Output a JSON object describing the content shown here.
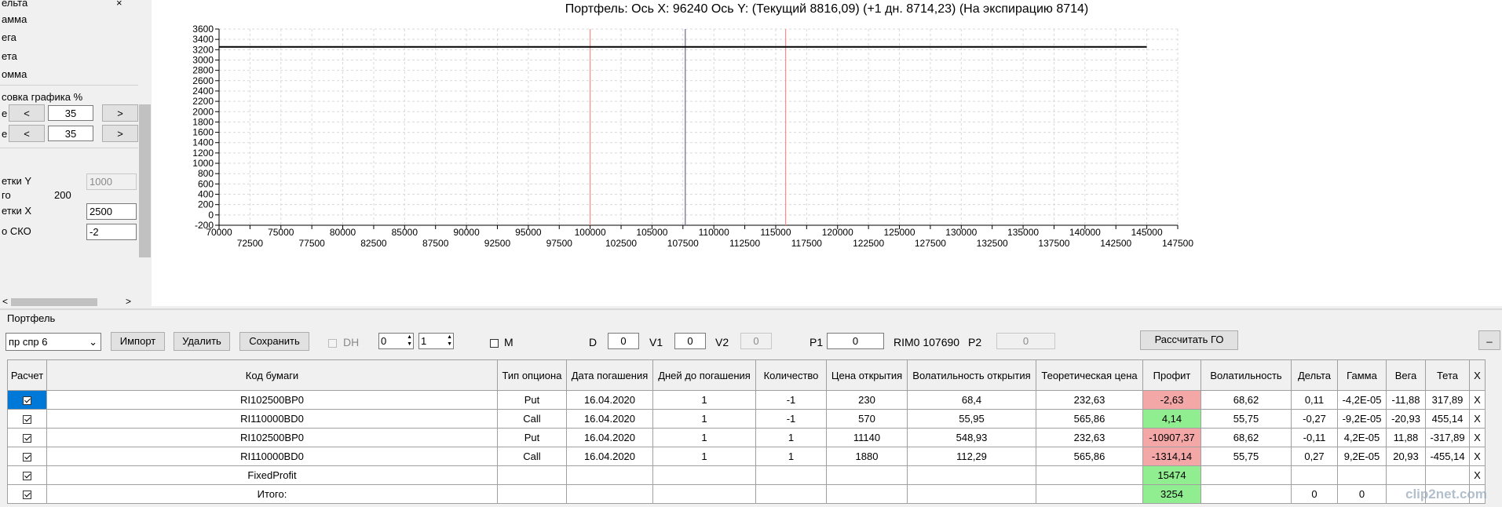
{
  "left_panel": {
    "greeks": [
      "ельта",
      "амма",
      "ега",
      "ета",
      "омма"
    ],
    "scale_title": "совка графика %",
    "scale_rows": [
      {
        "label": "е",
        "prev": "<",
        "value": "35",
        "next": ">"
      },
      {
        "label": "е",
        "prev": "<",
        "value": "35",
        "next": ">"
      }
    ],
    "grid_y_label": "етки Y",
    "grid_y_value": "1000",
    "total_label": "го",
    "total_value": "200",
    "grid_x_label": "етки X",
    "grid_x_value": "2500",
    "sko_label": "о СКО",
    "sko_value": "-2",
    "close_glyph": "×",
    "dropdown_glyph": "˅",
    "scroll_left": "<",
    "scroll_right": ">"
  },
  "chart_data": {
    "type": "line",
    "title": "Портфель: Ось X: 96240 Ось Y:  (Текущий 8816,09)  (+1 дн. 8714,23)  (На экспирацию 8714)",
    "xlim": [
      70000,
      147500
    ],
    "ylim": [
      -200,
      3600
    ],
    "x_ticks": [
      70000,
      72500,
      75000,
      77500,
      80000,
      82500,
      85000,
      87500,
      90000,
      92500,
      95000,
      97500,
      100000,
      102500,
      105000,
      107500,
      110000,
      112500,
      115000,
      117500,
      120000,
      122500,
      125000,
      127500,
      130000,
      132500,
      135000,
      137500,
      140000,
      142500,
      145000,
      147500
    ],
    "y_ticks": [
      -200,
      0,
      200,
      400,
      600,
      800,
      1000,
      1200,
      1400,
      1600,
      1800,
      2000,
      2200,
      2400,
      2600,
      2800,
      3000,
      3200,
      3400,
      3600
    ],
    "grid": true,
    "series": [
      {
        "x": [
          70000,
          145000
        ],
        "y": [
          3254,
          3254
        ],
        "color": "#000000"
      }
    ],
    "vlines": [
      {
        "x": 100000,
        "color": "#ff8a8a"
      },
      {
        "x": 107690,
        "color": "#6b6b8a"
      },
      {
        "x": 115800,
        "color": "#ff8a8a"
      }
    ]
  },
  "portfolio": {
    "section_label": "Портфель",
    "select_value": "пр спр 6",
    "import_label": "Импорт",
    "delete_label": "Удалить",
    "save_label": "Сохранить",
    "dh_label": "DH",
    "spin1_value": "0",
    "spin2_value": "1",
    "m_label": "M",
    "d_label": "D",
    "d_value": "0",
    "v1_label": "V1",
    "v1_value": "0",
    "v2_label": "V2",
    "v2_value": "0",
    "p1_label": "P1",
    "p1_value": "0",
    "rim_text": "RIM0 107690",
    "p2_label": "P2",
    "p2_value": "0",
    "calc_label": "Рассчитать ГО",
    "min_label": "_"
  },
  "table": {
    "headers": [
      "Расчет",
      "Код бумаги",
      "Тип опциона",
      "Дата погашения",
      "Дней до погашения",
      "Количество",
      "Цена открытия",
      "Волатильность открытия",
      "Теоретическая цена",
      "Профит",
      "Волатильность",
      "Дельта",
      "Гамма",
      "Вега",
      "Тета",
      "X"
    ],
    "rows": [
      {
        "code": "RI102500BP0",
        "type": "Put",
        "date": "16.04.2020",
        "days": "1",
        "qty": "-1",
        "price": "230",
        "vol_open": "68,4",
        "theo": "232,63",
        "profit": "-2,63",
        "vol": "68,62",
        "delta": "0,11",
        "gamma": "-4,2E-05",
        "vega": "-11,88",
        "theta": "317,89",
        "x": "X"
      },
      {
        "code": "RI110000BD0",
        "type": "Call",
        "date": "16.04.2020",
        "days": "1",
        "qty": "-1",
        "price": "570",
        "vol_open": "55,95",
        "theo": "565,86",
        "profit": "4,14",
        "vol": "55,75",
        "delta": "-0,27",
        "gamma": "-9,2E-05",
        "vega": "-20,93",
        "theta": "455,14",
        "x": "X"
      },
      {
        "code": "RI102500BP0",
        "type": "Put",
        "date": "16.04.2020",
        "days": "1",
        "qty": "1",
        "price": "11140",
        "vol_open": "548,93",
        "theo": "232,63",
        "profit": "-10907,37",
        "vol": "68,62",
        "delta": "-0,11",
        "gamma": "4,2E-05",
        "vega": "11,88",
        "theta": "-317,89",
        "x": "X"
      },
      {
        "code": "RI110000BD0",
        "type": "Call",
        "date": "16.04.2020",
        "days": "1",
        "qty": "1",
        "price": "1880",
        "vol_open": "112,29",
        "theo": "565,86",
        "profit": "-1314,14",
        "vol": "55,75",
        "delta": "0,27",
        "gamma": "9,2E-05",
        "vega": "20,93",
        "theta": "-455,14",
        "x": "X"
      }
    ],
    "fixed_row": {
      "code": "FixedProfit",
      "profit": "15474",
      "x": "X"
    },
    "total_row": {
      "code": "Итого:",
      "profit": "3254",
      "delta": "0",
      "gamma": "0"
    }
  },
  "watermark": "clip2net.com",
  "colors": {
    "profit_negative": "#f4a7a7",
    "profit_positive": "#90ee90",
    "selection": "#0078d7"
  }
}
